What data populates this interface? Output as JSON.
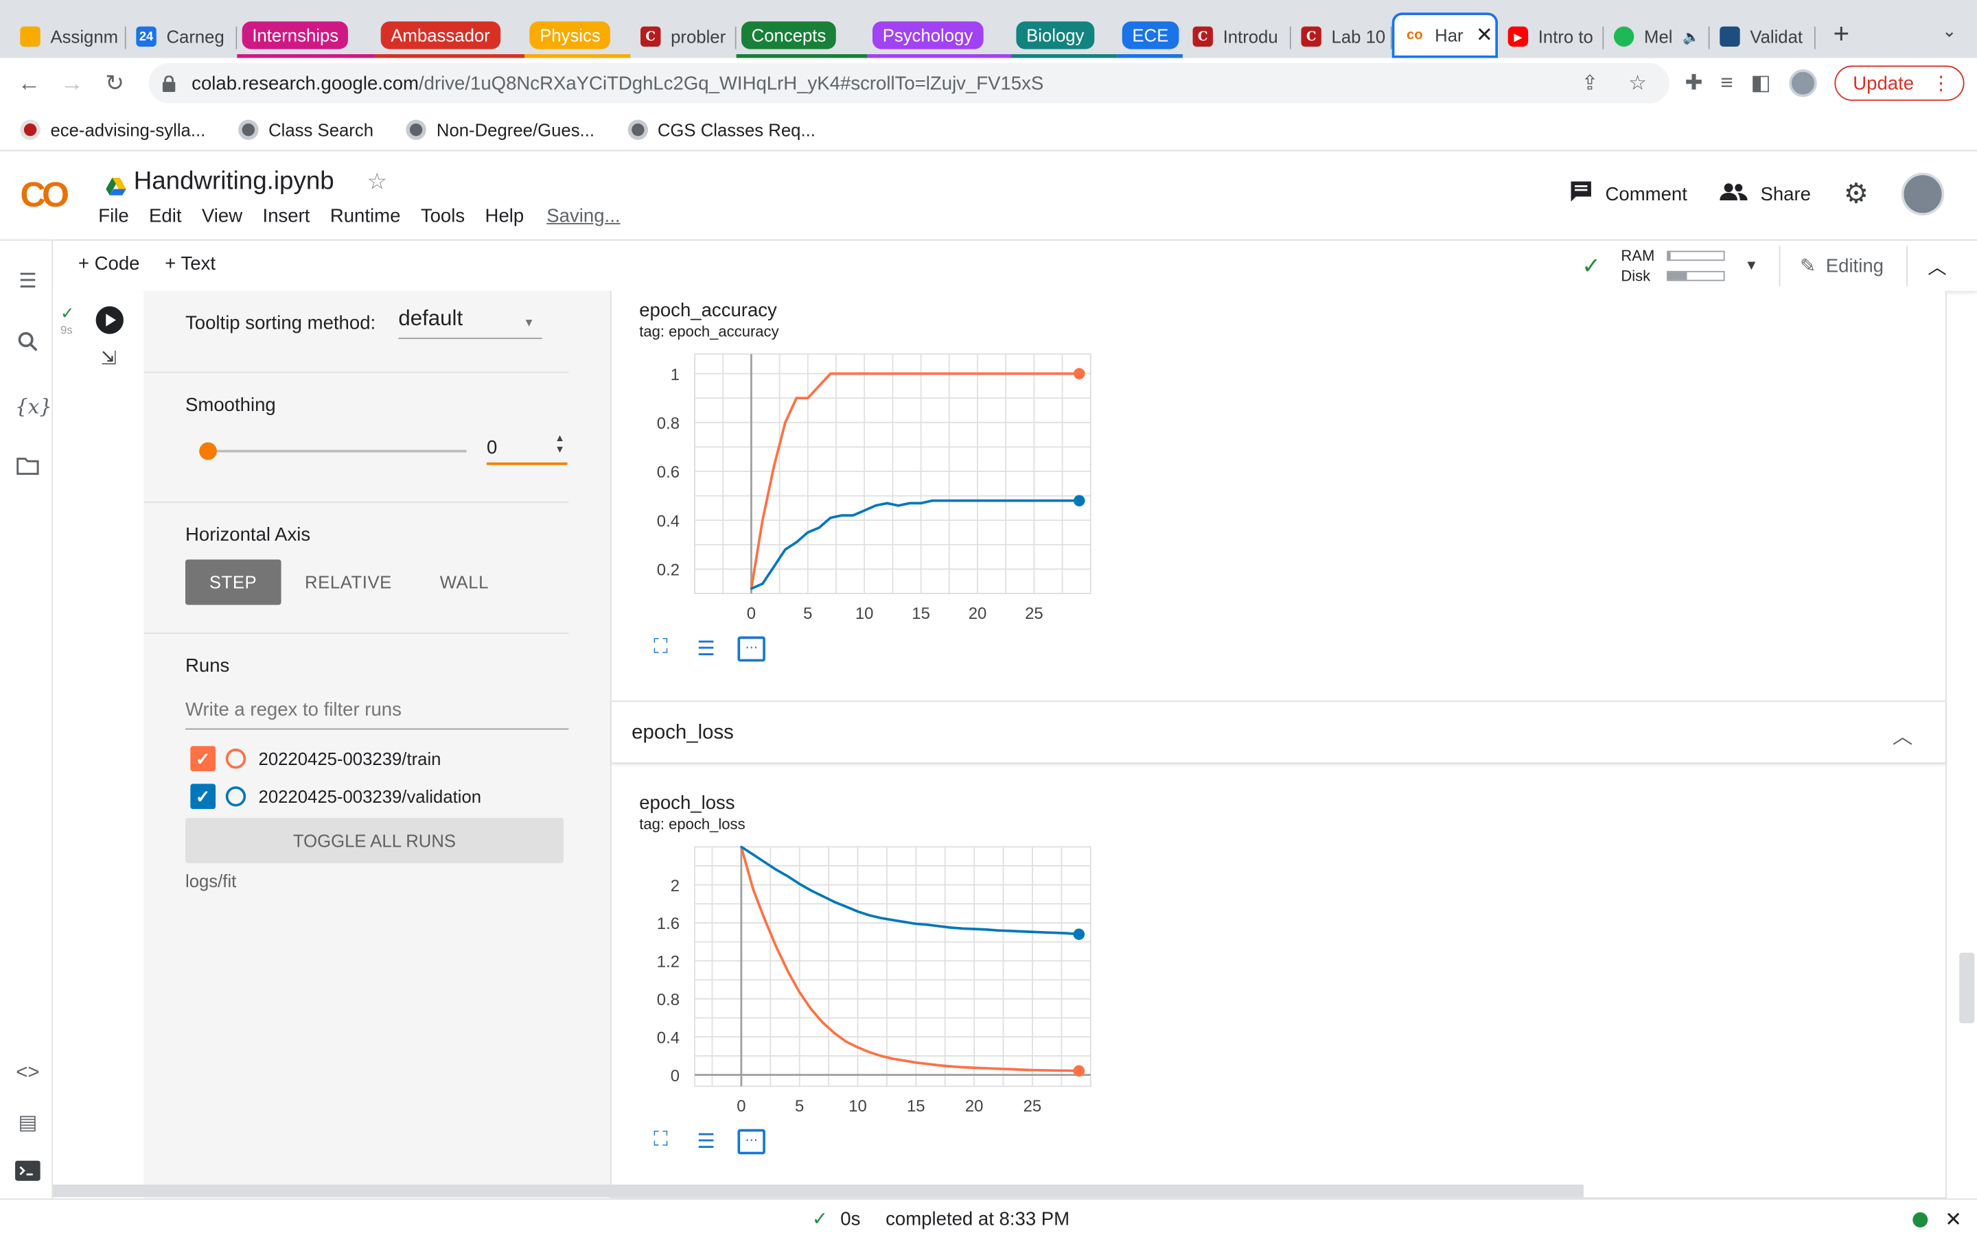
{
  "browser": {
    "tabs": [
      {
        "label": "Assignm",
        "icon": "pencil-icon",
        "kind": "tab"
      },
      {
        "label": "Carneg",
        "icon": "calendar-icon",
        "kind": "tab"
      },
      {
        "label": "Internships",
        "color": "#d01884",
        "kind": "group"
      },
      {
        "label": "Ambassador",
        "color": "#d93025",
        "kind": "group"
      },
      {
        "label": "Physics",
        "color": "#f9ab00",
        "kind": "group"
      },
      {
        "label": "probler",
        "icon": "canvas-icon",
        "kind": "tab"
      },
      {
        "label": "Concepts",
        "color": "#188038",
        "kind": "group"
      },
      {
        "label": "Psychology",
        "color": "#a142f4",
        "kind": "group"
      },
      {
        "label": "Biology",
        "color": "#12837e",
        "kind": "group"
      },
      {
        "label": "ECE",
        "color": "#1a73e8",
        "kind": "group"
      },
      {
        "label": "Introdu",
        "icon": "canvas-icon",
        "kind": "tab"
      },
      {
        "label": "Lab 10",
        "icon": "canvas-icon",
        "kind": "tab"
      },
      {
        "label": "Har",
        "icon": "colab-icon",
        "kind": "active"
      },
      {
        "label": "Intro to",
        "icon": "youtube-icon",
        "kind": "tab"
      },
      {
        "label": "Mel",
        "icon": "spotify-icon",
        "kind": "tab"
      },
      {
        "label": "Validat",
        "icon": "tds-icon",
        "kind": "tab"
      }
    ],
    "url_host": "colab.research.google.com",
    "url_path": "/drive/1uQ8NcRXaYCiTDghLc2Gq_WIHqLrH_yK4#scrollTo=lZujv_FV15xS",
    "update_label": "Update",
    "bookmarks": [
      "ece-advising-sylla...",
      "Class Search",
      "Non-Degree/Gues...",
      "CGS Classes Req..."
    ]
  },
  "colab": {
    "logo": "CO",
    "title": "Handwriting.ipynb",
    "menu": [
      "File",
      "Edit",
      "View",
      "Insert",
      "Runtime",
      "Tools",
      "Help"
    ],
    "saving": "Saving...",
    "comment_label": "Comment",
    "share_label": "Share",
    "add_code": "+ Code",
    "add_text": "+ Text",
    "ram_label": "RAM",
    "disk_label": "Disk",
    "ram_fraction": 0.06,
    "disk_fraction": 0.35,
    "editing_label": "Editing",
    "cell_time": "9s"
  },
  "tensorboard": {
    "tooltip_label": "Tooltip sorting method:",
    "tooltip_value": "default",
    "smoothing_label": "Smoothing",
    "smoothing_value": "0",
    "haxis_label": "Horizontal Axis",
    "haxis_options": [
      "STEP",
      "RELATIVE",
      "WALL"
    ],
    "haxis_selected": "STEP",
    "runs_label": "Runs",
    "filter_placeholder": "Write a regex to filter runs",
    "runs": [
      {
        "name": "20220425-003239/train",
        "color": "#ff7043"
      },
      {
        "name": "20220425-003239/validation",
        "color": "#0077bb"
      }
    ],
    "toggle_label": "TOGGLE ALL RUNS",
    "logdir": "logs/fit",
    "section_label": "epoch_loss"
  },
  "chart_data": [
    {
      "type": "line",
      "title": "epoch_accuracy",
      "subtitle": "tag: epoch_accuracy",
      "x": [
        0,
        1,
        2,
        3,
        4,
        5,
        6,
        7,
        8,
        9,
        10,
        11,
        12,
        13,
        14,
        15,
        16,
        17,
        18,
        19,
        20,
        21,
        22,
        23,
        24,
        25,
        26,
        27,
        28,
        29
      ],
      "series": [
        {
          "name": "20220425-003239/train",
          "color": "#ff7043",
          "values": [
            0.12,
            0.4,
            0.62,
            0.8,
            0.9,
            0.9,
            0.95,
            1,
            1,
            1,
            1,
            1,
            1,
            1,
            1,
            1,
            1,
            1,
            1,
            1,
            1,
            1,
            1,
            1,
            1,
            1,
            1,
            1,
            1,
            1
          ]
        },
        {
          "name": "20220425-003239/validation",
          "color": "#0077bb",
          "values": [
            0.12,
            0.14,
            0.21,
            0.28,
            0.31,
            0.35,
            0.37,
            0.41,
            0.42,
            0.42,
            0.44,
            0.46,
            0.47,
            0.46,
            0.47,
            0.47,
            0.48,
            0.48,
            0.48,
            0.48,
            0.48,
            0.48,
            0.48,
            0.48,
            0.48,
            0.48,
            0.48,
            0.48,
            0.48,
            0.48
          ]
        }
      ],
      "xticks": [
        0,
        5,
        10,
        15,
        20,
        25
      ],
      "yticks": [
        0.2,
        0.4,
        0.6,
        0.8,
        1
      ],
      "xlim": [
        -5,
        30
      ],
      "ylim": [
        0.1,
        1.08
      ]
    },
    {
      "type": "line",
      "title": "epoch_loss",
      "subtitle": "tag: epoch_loss",
      "x": [
        0,
        1,
        2,
        3,
        4,
        5,
        6,
        7,
        8,
        9,
        10,
        11,
        12,
        13,
        14,
        15,
        16,
        17,
        18,
        19,
        20,
        21,
        22,
        23,
        24,
        25,
        26,
        27,
        28,
        29
      ],
      "series": [
        {
          "name": "20220425-003239/train",
          "color": "#ff7043",
          "values": [
            2.4,
            1.96,
            1.64,
            1.35,
            1.09,
            0.87,
            0.69,
            0.55,
            0.44,
            0.35,
            0.29,
            0.24,
            0.2,
            0.17,
            0.15,
            0.13,
            0.115,
            0.1,
            0.09,
            0.08,
            0.075,
            0.07,
            0.065,
            0.06,
            0.055,
            0.05,
            0.048,
            0.046,
            0.044,
            0.042
          ]
        },
        {
          "name": "20220425-003239/validation",
          "color": "#0077bb",
          "values": [
            2.4,
            2.32,
            2.24,
            2.16,
            2.09,
            2.01,
            1.94,
            1.88,
            1.82,
            1.77,
            1.72,
            1.68,
            1.65,
            1.63,
            1.61,
            1.59,
            1.58,
            1.565,
            1.55,
            1.54,
            1.535,
            1.53,
            1.52,
            1.515,
            1.51,
            1.505,
            1.5,
            1.495,
            1.49,
            1.48
          ]
        }
      ],
      "xticks": [
        0,
        5,
        10,
        15,
        20,
        25
      ],
      "yticks": [
        0,
        0.4,
        0.8,
        1.2,
        1.6,
        2
      ],
      "xlim": [
        -4,
        30
      ],
      "ylim": [
        -0.12,
        2.4
      ]
    }
  ],
  "status": {
    "time": "0s",
    "completed": "completed at 8:33 PM"
  }
}
